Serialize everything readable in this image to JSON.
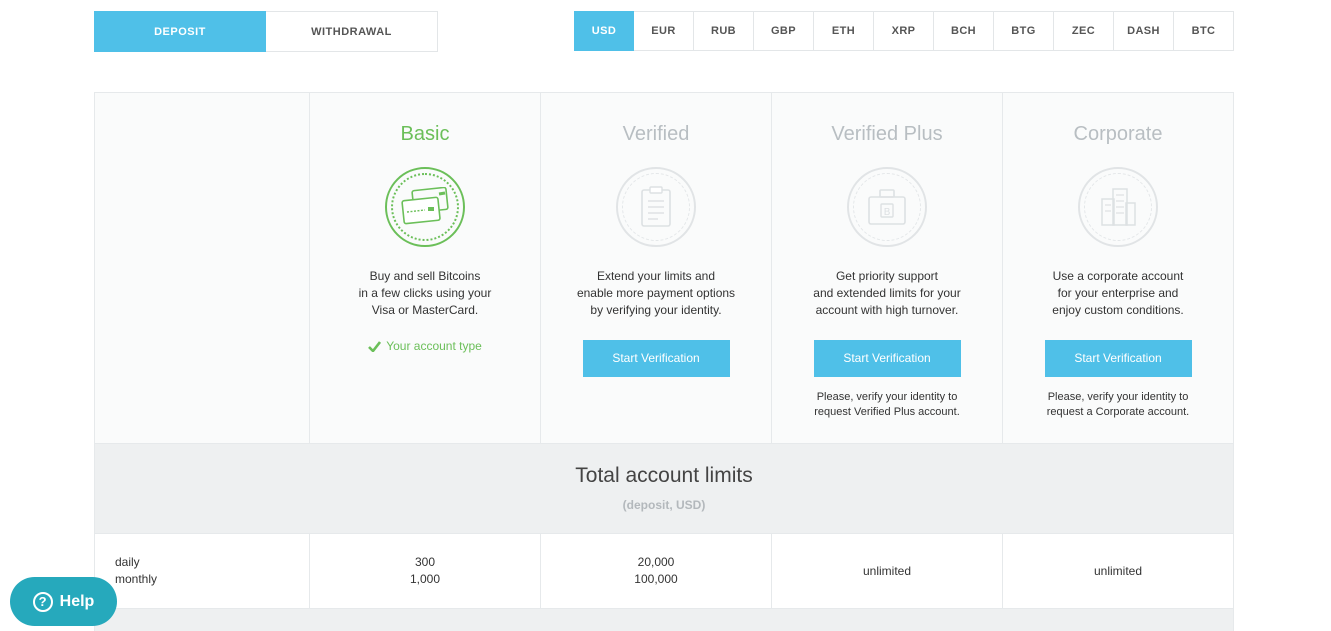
{
  "toggle": {
    "deposit": "DEPOSIT",
    "withdrawal": "WITHDRAWAL"
  },
  "currencies": [
    "USD",
    "EUR",
    "RUB",
    "GBP",
    "ETH",
    "XRP",
    "BCH",
    "BTG",
    "ZEC",
    "DASH",
    "BTC"
  ],
  "plans": {
    "basic": {
      "title": "Basic",
      "desc1": "Buy and sell Bitcoins",
      "desc2": "in a few clicks using your",
      "desc3": "Visa or MasterCard.",
      "status": "Your account type"
    },
    "verified": {
      "title": "Verified",
      "desc1": "Extend your limits and",
      "desc2": "enable more payment options",
      "desc3": "by verifying your identity.",
      "button": "Start Verification"
    },
    "verified_plus": {
      "title": "Verified Plus",
      "desc1": "Get priority support",
      "desc2": "and extended limits for your",
      "desc3": "account with high turnover.",
      "button": "Start Verification",
      "note1": "Please, verify your identity to",
      "note2": "request Verified Plus account."
    },
    "corporate": {
      "title": "Corporate",
      "desc1": "Use a corporate account",
      "desc2": "for your enterprise and",
      "desc3": "enjoy custom conditions.",
      "button": "Start Verification",
      "note1": "Please, verify your identity to",
      "note2": "request a Corporate account."
    }
  },
  "limits": {
    "title": "Total account limits",
    "subtitle": "(deposit, USD)",
    "labels": {
      "daily": "daily",
      "monthly": "monthly"
    },
    "basic": {
      "daily": "300",
      "monthly": "1,000"
    },
    "verified": {
      "daily": "20,000",
      "monthly": "100,000"
    },
    "verified_plus": "unlimited",
    "corporate": "unlimited"
  },
  "help": {
    "label": "Help",
    "icon": "question-icon"
  },
  "colors": {
    "accent": "#4fc0e8",
    "green": "#6bbf59",
    "help": "#26a9bc"
  }
}
